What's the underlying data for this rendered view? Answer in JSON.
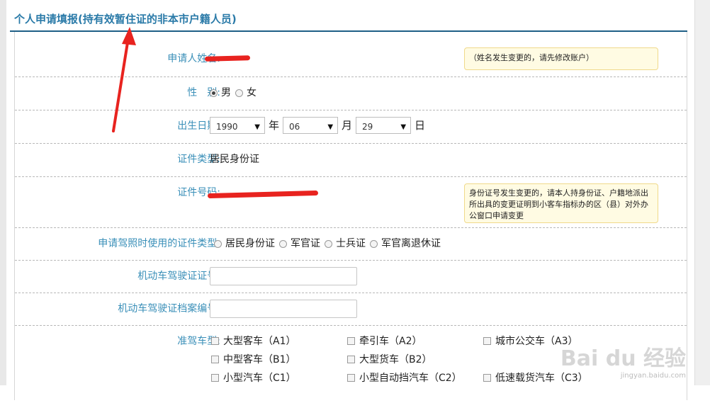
{
  "page_title": "个人申请填报(持有效暂住证的非本市户籍人员)",
  "fields": {
    "name": {
      "label": "申请人姓名:",
      "note": "（姓名发生变更的，请先修改账户）"
    },
    "gender": {
      "label": "性　别:",
      "options": [
        {
          "label": "男",
          "checked": true
        },
        {
          "label": "女",
          "checked": false
        }
      ]
    },
    "birth": {
      "label": "出生日期:",
      "year": "1990",
      "year_unit": "年",
      "month": "06",
      "month_unit": "月",
      "day": "29",
      "day_unit": "日"
    },
    "id_type": {
      "label": "证件类型:",
      "value": "居民身份证"
    },
    "id_number": {
      "label": "证件号码:",
      "note": "身份证号发生变更的，请本人持身份证、户籍地派出所出具的变更证明到小客车指标办的区（县）对外办公窗口申请变更"
    },
    "license_id_type": {
      "label": "申请驾照时使用的证件类型:",
      "options": [
        {
          "label": "居民身份证"
        },
        {
          "label": "军官证"
        },
        {
          "label": "士兵证"
        },
        {
          "label": "军官离退休证"
        }
      ]
    },
    "license_no": {
      "label": "机动车驾驶证证号:",
      "value": ""
    },
    "license_file_no": {
      "label": "机动车驾驶证档案编号:",
      "value": ""
    },
    "vehicle_class": {
      "label": "准驾车型:",
      "options": [
        {
          "label": "大型客车（A1）"
        },
        {
          "label": "牵引车（A2）"
        },
        {
          "label": "城市公交车（A3）"
        },
        {
          "label": "中型客车（B1）"
        },
        {
          "label": "大型货车（B2）"
        },
        {
          "label": "小型汽车（C1）"
        },
        {
          "label": "小型自动挡汽车（C2）"
        },
        {
          "label": "低速载货汽车（C3）"
        }
      ]
    }
  },
  "watermark": {
    "text": "Bai du 经验",
    "sub": "jingyan.baidu.com"
  },
  "colors": {
    "label": "#3a8fb8",
    "title": "#2a7aa8",
    "rule": "#1f5f86",
    "redaction": "#e8231f",
    "note_bg": "#fffbe3"
  }
}
